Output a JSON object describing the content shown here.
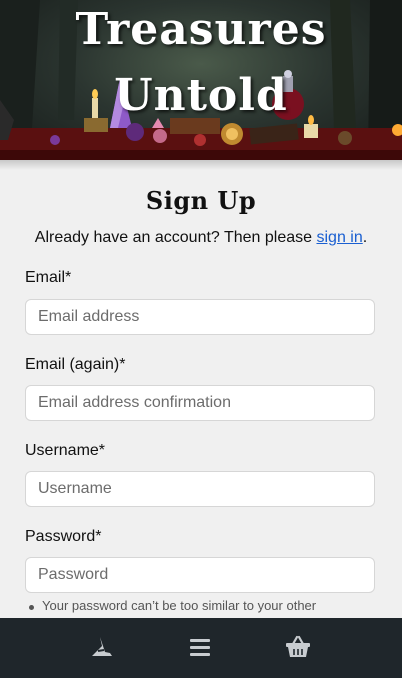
{
  "hero": {
    "title_line1": "Treasures",
    "title_line2": "Untold"
  },
  "signup": {
    "heading": "Sign Up",
    "account_prefix": "Already have an account? Then please ",
    "signin_link": "sign in",
    "account_suffix": "."
  },
  "fields": {
    "email": {
      "label": "Email*",
      "placeholder": "Email address"
    },
    "email_again": {
      "label": "Email (again)*",
      "placeholder": "Email address confirmation"
    },
    "username": {
      "label": "Username*",
      "placeholder": "Username"
    },
    "password": {
      "label": "Password*",
      "placeholder": "Password"
    }
  },
  "password_hint": "Your password can’t be too similar to your other",
  "nav": {
    "home_icon": "witch-hat-icon",
    "menu_icon": "hamburger-menu-icon",
    "cart_icon": "shopping-basket-icon"
  },
  "colors": {
    "nav_bg": "#1f262b",
    "link": "#1a5fd1",
    "page_bg": "#f0f0f0"
  }
}
